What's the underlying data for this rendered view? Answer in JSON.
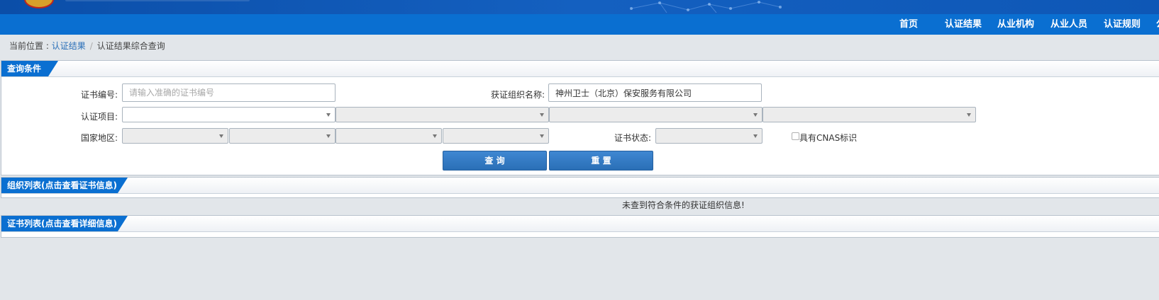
{
  "nav": {
    "items": [
      {
        "label": "首页"
      },
      {
        "label": "认证结果"
      },
      {
        "label": "从业机构"
      },
      {
        "label": "从业人员"
      },
      {
        "label": "认证规则"
      },
      {
        "label": "公"
      }
    ]
  },
  "breadcrumb": {
    "prefix": "当前位置 : ",
    "link": "认证结果",
    "separator": "/",
    "current": "认证结果综合查询"
  },
  "query": {
    "title": "查询条件",
    "cert_no_label": "证书编号:",
    "cert_no_placeholder": "请输入准确的证书编号",
    "cert_no_value": "",
    "org_name_label": "获证组织名称:",
    "org_name_value": "神州卫士（北京）保安服务有限公司",
    "project_label": "认证项目:",
    "region_label": "国家地区:",
    "status_label": "证书状态:",
    "cnas_label": "具有CNAS标识",
    "cnas_checked": false,
    "search_button": "查 询",
    "reset_button": "重 置"
  },
  "org_list": {
    "title": "组织列表(点击查看证书信息)",
    "empty_message": "未查到符合条件的获证组织信息!"
  },
  "cert_list": {
    "title": "证书列表(点击查看详细信息)"
  },
  "colors": {
    "nav_bg": "#0a6fd1",
    "banner_bg": "#0b4ea8",
    "button_bg": "#2f78c4",
    "page_bg": "#e2e6ea"
  }
}
